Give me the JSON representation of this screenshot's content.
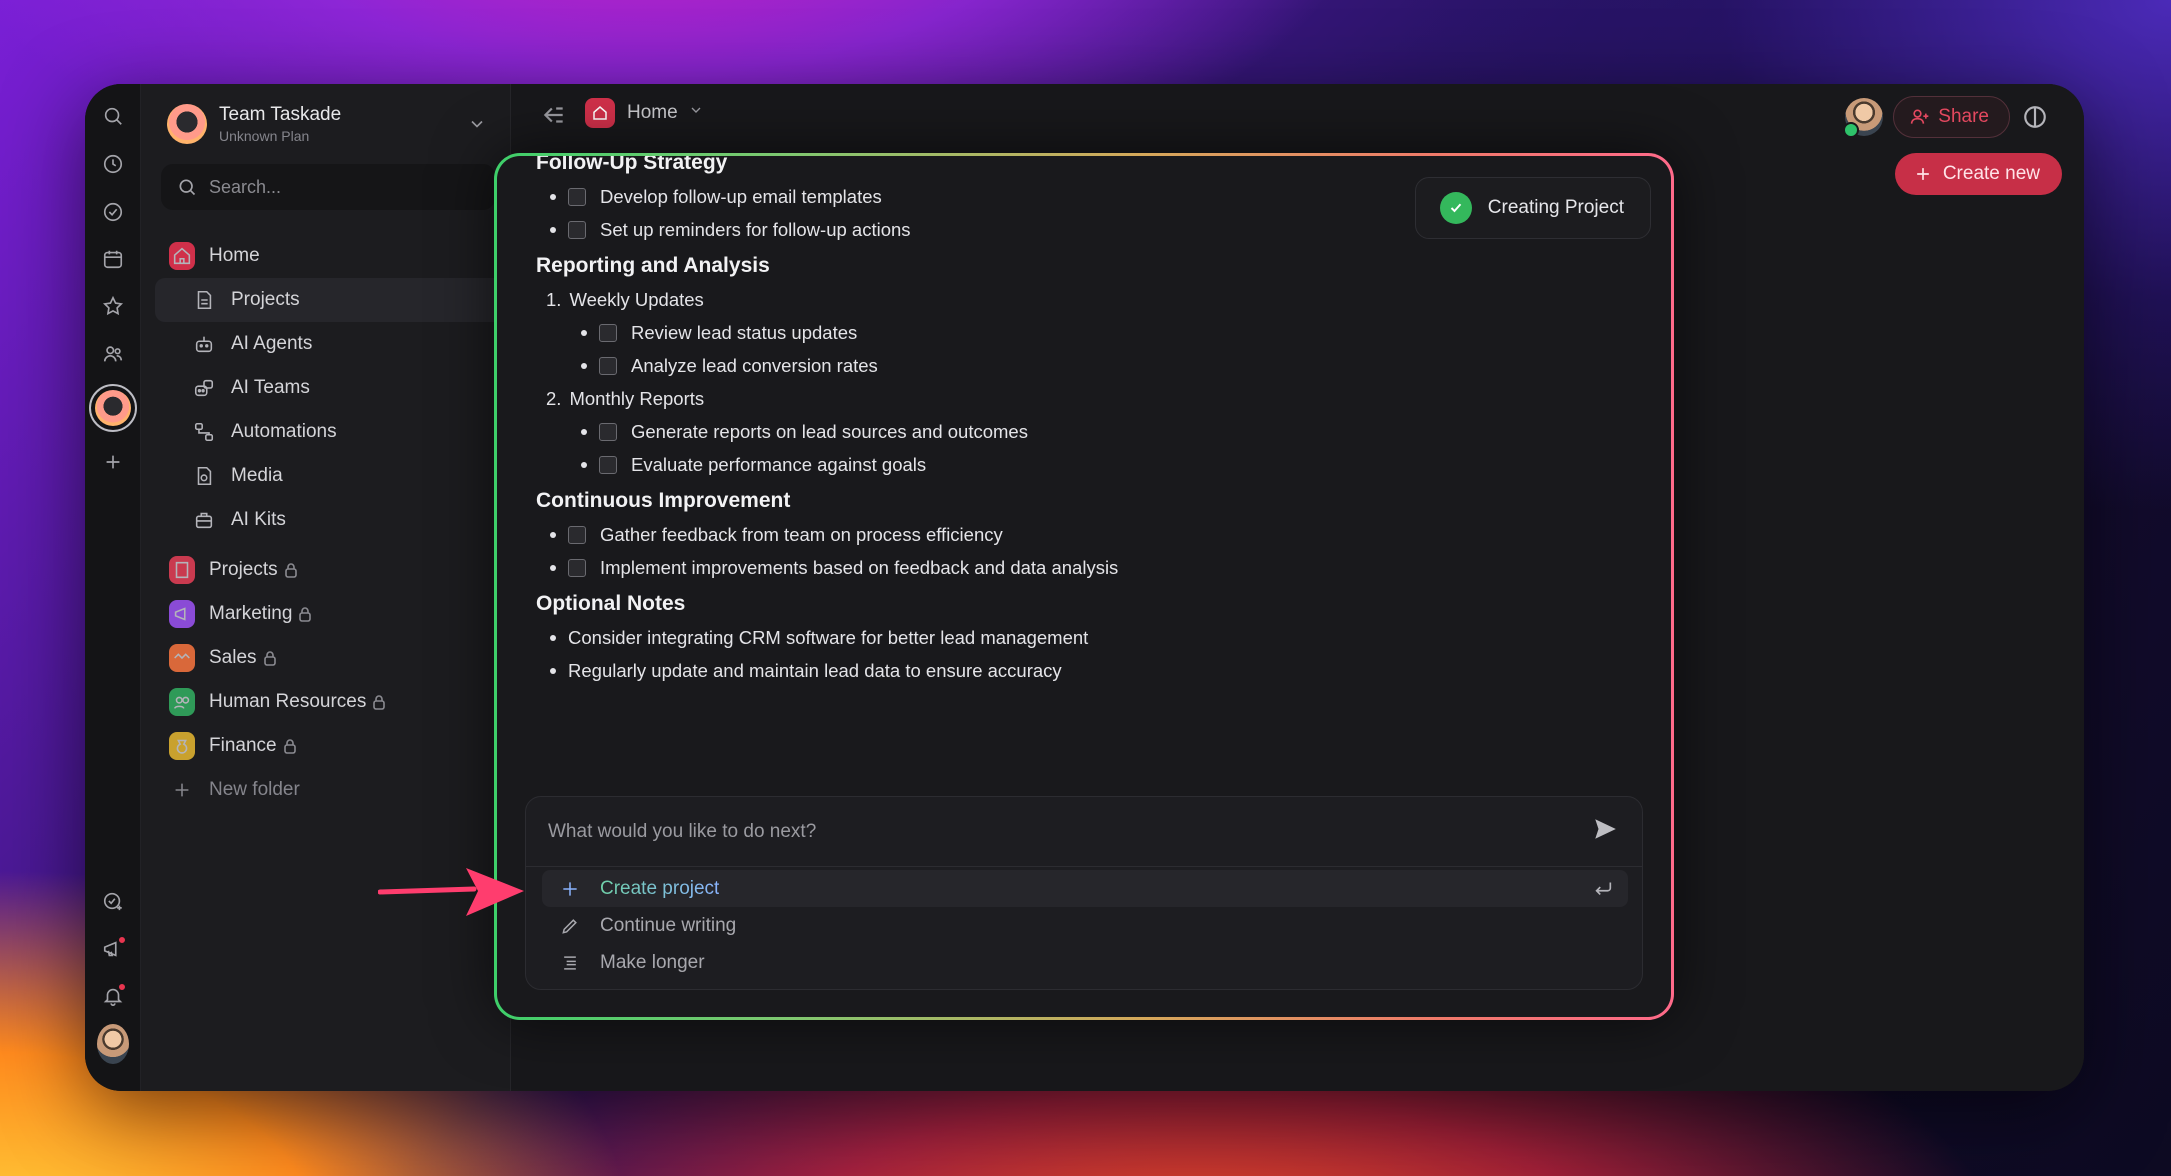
{
  "workspace": {
    "team_name": "Team Taskade",
    "plan": "Unknown Plan"
  },
  "search": {
    "placeholder": "Search..."
  },
  "sidebar": {
    "home": "Home",
    "sub_items": [
      {
        "label": "Projects",
        "icon": "document-icon"
      },
      {
        "label": "AI Agents",
        "icon": "robot-icon"
      },
      {
        "label": "AI Teams",
        "icon": "robot-team-icon"
      },
      {
        "label": "Automations",
        "icon": "flow-icon"
      },
      {
        "label": "Media",
        "icon": "media-icon"
      },
      {
        "label": "AI Kits",
        "icon": "kit-icon"
      }
    ],
    "folders": [
      {
        "label": "Projects",
        "color": "#c93a4f"
      },
      {
        "label": "Marketing",
        "color": "#8a4bd6"
      },
      {
        "label": "Sales",
        "color": "#d9683a"
      },
      {
        "label": "Human Resources",
        "color": "#2f9a58"
      },
      {
        "label": "Finance",
        "color": "#c9a12e"
      }
    ],
    "new_folder": "New folder"
  },
  "topbar": {
    "breadcrumb": "Home",
    "share": "Share",
    "create_new": "Create new"
  },
  "dialog": {
    "status": "Creating Project",
    "doc": {
      "follow_up_heading": "Follow-Up Strategy",
      "follow_up_items": [
        "Develop follow-up email templates",
        "Set up reminders for follow-up actions"
      ],
      "reporting_heading": "Reporting and Analysis",
      "weekly": "Weekly Updates",
      "weekly_items": [
        "Review lead status updates",
        "Analyze lead conversion rates"
      ],
      "monthly": "Monthly Reports",
      "monthly_items": [
        "Generate reports on lead sources and outcomes",
        "Evaluate performance against goals"
      ],
      "ci_heading": "Continuous Improvement",
      "ci_items": [
        "Gather feedback from team on process efficiency",
        "Implement improvements based on feedback and data analysis"
      ],
      "notes_heading": "Optional Notes",
      "notes_items": [
        "Consider integrating CRM software for better lead management",
        "Regularly update and maintain lead data to ensure accuracy"
      ]
    },
    "prompt_placeholder": "What would you like to do next?",
    "suggestions": [
      {
        "label": "Create project",
        "icon": "plus-icon"
      },
      {
        "label": "Continue writing",
        "icon": "pencil-icon"
      },
      {
        "label": "Make longer",
        "icon": "lines-icon"
      }
    ]
  },
  "colors": {
    "accent": "#c72f47",
    "success": "#34b85c"
  }
}
